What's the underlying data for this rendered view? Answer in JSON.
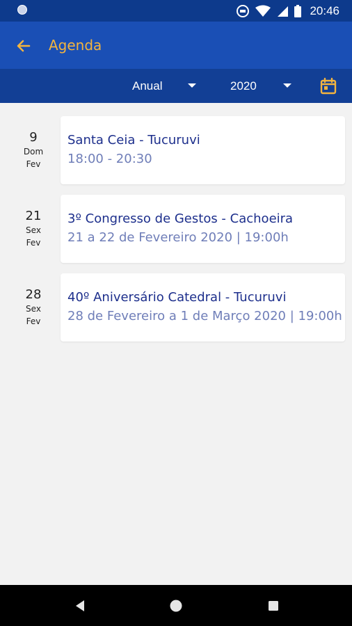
{
  "status_bar": {
    "time": "20:46"
  },
  "app_bar": {
    "title": "Agenda"
  },
  "filters": {
    "period": "Anual",
    "year": "2020"
  },
  "events": [
    {
      "day": "9",
      "weekday": "Dom",
      "month": "Fev",
      "title": "Santa Ceia - Tucuruvi",
      "time": "18:00 - 20:30"
    },
    {
      "day": "21",
      "weekday": "Sex",
      "month": "Fev",
      "title": "3º Congresso de Gestos - Cachoeira",
      "time": "21 a 22 de Fevereiro 2020 | 19:00h"
    },
    {
      "day": "28",
      "weekday": "Sex",
      "month": "Fev",
      "title": "40º Aniversário Catedral - Tucuruvi",
      "time": "28 de Fevereiro a 1 de Março 2020 | 19:00h"
    }
  ],
  "colors": {
    "app_bar": "#1a4fb5",
    "filter_bar": "#123f95",
    "accent": "#f3b43f",
    "title_text": "#1d2f8c",
    "time_text": "#6f7eb8"
  },
  "icons": {
    "back": "arrow-left-icon",
    "calendar": "calendar-icon"
  }
}
